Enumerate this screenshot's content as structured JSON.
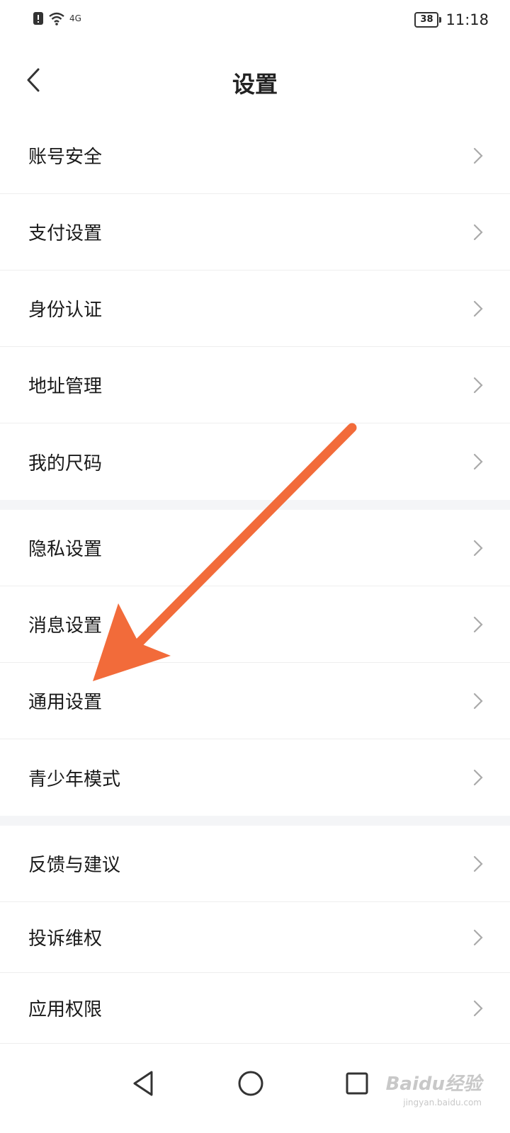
{
  "status_bar": {
    "time": "11:18",
    "battery": "38",
    "network_text": "4G"
  },
  "header": {
    "title": "设置"
  },
  "groups": [
    {
      "items": [
        {
          "label": "账号安全"
        },
        {
          "label": "支付设置"
        },
        {
          "label": "身份认证"
        },
        {
          "label": "地址管理"
        },
        {
          "label": "我的尺码"
        }
      ]
    },
    {
      "items": [
        {
          "label": "隐私设置"
        },
        {
          "label": "消息设置"
        },
        {
          "label": "通用设置"
        },
        {
          "label": "青少年模式"
        }
      ]
    },
    {
      "items": [
        {
          "label": "反馈与建议"
        },
        {
          "label": "投诉维权"
        },
        {
          "label": "应用权限"
        }
      ]
    }
  ],
  "watermark": {
    "logo": "Baidu经验",
    "url": "jingyan.baidu.com"
  },
  "colors": {
    "annotation_arrow": "#f26b3a",
    "group_gap": "#f4f5f7"
  }
}
